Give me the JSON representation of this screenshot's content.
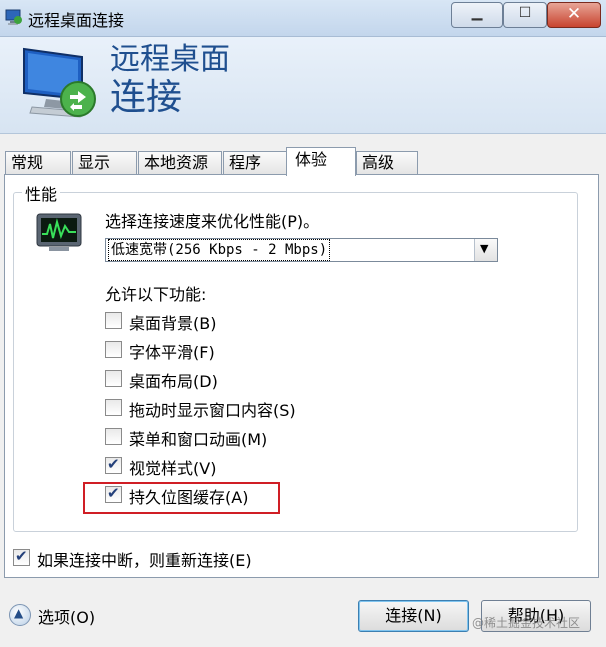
{
  "window": {
    "title": "远程桌面连接",
    "icon": "remote-desktop-icon",
    "controls": {
      "minimize": "minimize-icon",
      "maximize": "maximize-icon",
      "close": "close-icon"
    }
  },
  "banner": {
    "line1": "远程桌面",
    "line2": "连接",
    "icon": "computer-connection-icon"
  },
  "tabs": [
    {
      "label": "常规",
      "active": false
    },
    {
      "label": "显示",
      "active": false
    },
    {
      "label": "本地资源",
      "active": false
    },
    {
      "label": "程序",
      "active": false
    },
    {
      "label": "体验",
      "active": true
    },
    {
      "label": "高级",
      "active": false
    }
  ],
  "performance": {
    "group_title": "性能",
    "icon": "performance-monitor-icon",
    "speed_label": "选择连接速度来优化性能(P)。",
    "speed_value": "低速宽带(256 Kbps - 2 Mbps)",
    "allow_label": "允许以下功能:",
    "options": [
      {
        "label": "桌面背景(B)",
        "checked": false
      },
      {
        "label": "字体平滑(F)",
        "checked": false
      },
      {
        "label": "桌面布局(D)",
        "checked": false
      },
      {
        "label": "拖动时显示窗口内容(S)",
        "checked": false
      },
      {
        "label": "菜单和窗口动画(M)",
        "checked": false
      },
      {
        "label": "视觉样式(V)",
        "checked": true
      },
      {
        "label": "持久位图缓存(A)",
        "checked": true
      }
    ],
    "highlight_color": "#d01e25"
  },
  "reconnect": {
    "label": "如果连接中断，则重新连接(E)",
    "checked": true
  },
  "footer": {
    "options_label": "选项(O)",
    "connect_label": "连接(N)",
    "help_label": "帮助(H)",
    "watermark": "@稀土掘金技术社区"
  }
}
